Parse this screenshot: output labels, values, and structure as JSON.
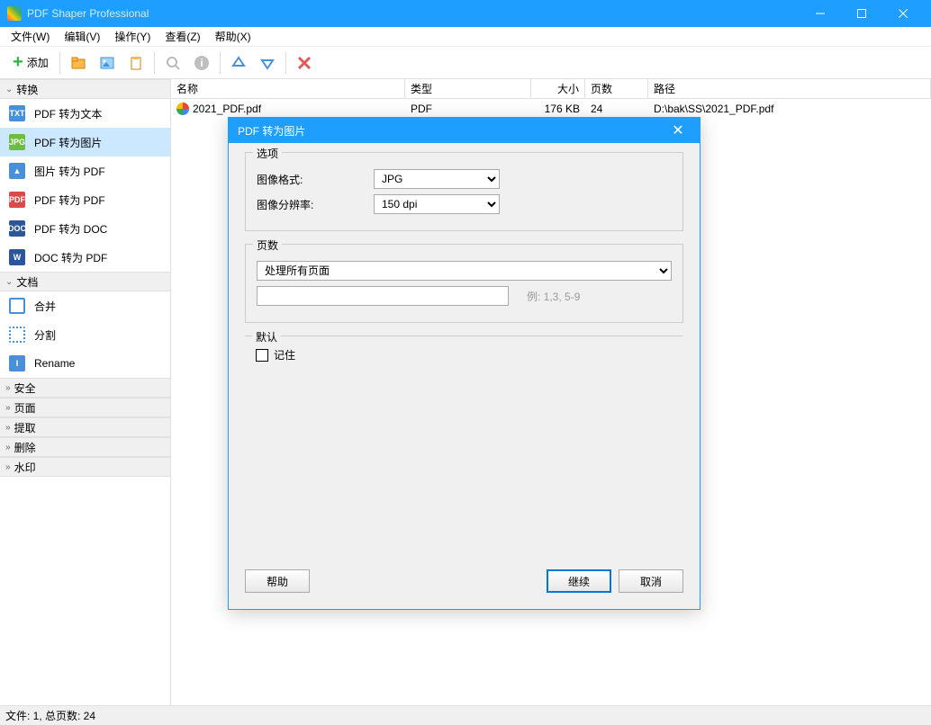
{
  "window": {
    "title": "PDF Shaper Professional"
  },
  "menu": {
    "file": "文件(W)",
    "edit": "编辑(V)",
    "action": "操作(Y)",
    "view": "查看(Z)",
    "help": "帮助(X)"
  },
  "toolbar": {
    "add_label": "添加"
  },
  "sidebar": {
    "cat_convert": "转换",
    "cat_document": "文档",
    "cat_security": "安全",
    "cat_page": "页面",
    "cat_extract": "提取",
    "cat_delete": "删除",
    "cat_watermark": "水印",
    "convert": {
      "pdf_to_text": "PDF 转为文本",
      "pdf_to_image": "PDF 转为图片",
      "image_to_pdf": "图片 转为 PDF",
      "pdf_to_pdf": "PDF 转为 PDF",
      "pdf_to_doc": "PDF 转为 DOC",
      "doc_to_pdf": "DOC 转为 PDF"
    },
    "document": {
      "merge": "合并",
      "split": "分割",
      "rename": "Rename"
    }
  },
  "columns": {
    "name": "名称",
    "type": "类型",
    "size": "大小",
    "pages": "页数",
    "path": "路径"
  },
  "file": {
    "name": "2021_PDF.pdf",
    "type": "PDF",
    "size": "176 KB",
    "pages": "24",
    "path": "D:\\bak\\SS\\2021_PDF.pdf"
  },
  "dialog": {
    "title": "PDF 转为图片",
    "options_legend": "选项",
    "image_format_label": "图像格式:",
    "image_format_value": "JPG",
    "resolution_label": "图像分辨率:",
    "resolution_value": "150 dpi",
    "pages_legend": "页数",
    "pages_mode": "处理所有页面",
    "pages_hint": "例: 1,3, 5-9",
    "default_legend": "默认",
    "remember_label": "记住",
    "help_btn": "帮助",
    "continue_btn": "继续",
    "cancel_btn": "取消"
  },
  "status": {
    "text": "文件: 1, 总页数: 24"
  }
}
